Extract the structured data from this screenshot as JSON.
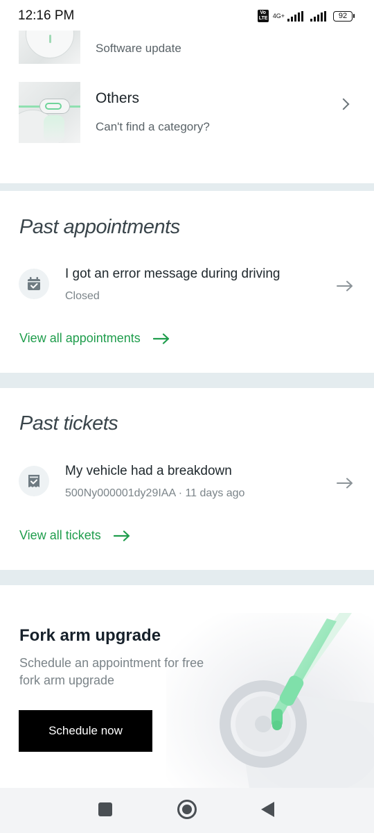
{
  "status_bar": {
    "time": "12:16 PM",
    "volte": "Vo LTE",
    "network": "4G+",
    "battery": "92"
  },
  "categories": [
    {
      "title": "",
      "subtitle": "Software update"
    },
    {
      "title": "Others",
      "subtitle": "Can't find a category?"
    }
  ],
  "past_appointments": {
    "title": "Past appointments",
    "items": [
      {
        "title": "I got an error message during driving",
        "subtitle": "Closed"
      }
    ],
    "view_all": "View all appointments"
  },
  "past_tickets": {
    "title": "Past tickets",
    "items": [
      {
        "title": "My vehicle had a breakdown",
        "subtitle": "500Ny000001dy29IAA · 11 days ago"
      }
    ],
    "view_all": "View all tickets"
  },
  "promo": {
    "title": "Fork arm upgrade",
    "description": "Schedule an appointment for free fork arm upgrade",
    "button": "Schedule now"
  },
  "colors": {
    "accent_green": "#1f9d4c",
    "divider": "#e4ecef",
    "button_bg": "#000000"
  },
  "icons": {
    "appointment": "calendar-check-icon",
    "ticket": "receipt-check-icon",
    "nav": [
      "recents-square-icon",
      "home-circle-icon",
      "back-triangle-icon"
    ]
  }
}
